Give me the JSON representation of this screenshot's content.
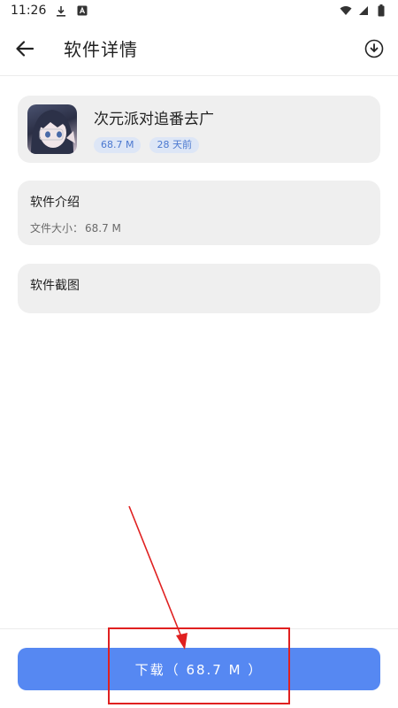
{
  "status_bar": {
    "time": "11:26",
    "icons": [
      "download-icon",
      "notification-a-icon",
      "wifi-icon",
      "signal-icon",
      "battery-icon"
    ]
  },
  "app_bar": {
    "title": "软件详情",
    "back_icon": "arrow-left-icon",
    "download_icon": "download-circle-icon"
  },
  "app_info": {
    "name": "次元派对追番去广",
    "size_badge": "68.7 M",
    "time_badge": "28 天前"
  },
  "intro": {
    "title": "软件介绍",
    "size_label": "文件大小：",
    "size_value": "68.7 M"
  },
  "screenshots": {
    "title": "软件截图"
  },
  "download_button": {
    "label": "下载（ 68.7 M ）"
  },
  "colors": {
    "primary": "#5688f2",
    "card_bg": "#efefef",
    "badge_bg": "#dde6f6",
    "badge_text": "#4b78cf",
    "annotation": "#e02020"
  }
}
